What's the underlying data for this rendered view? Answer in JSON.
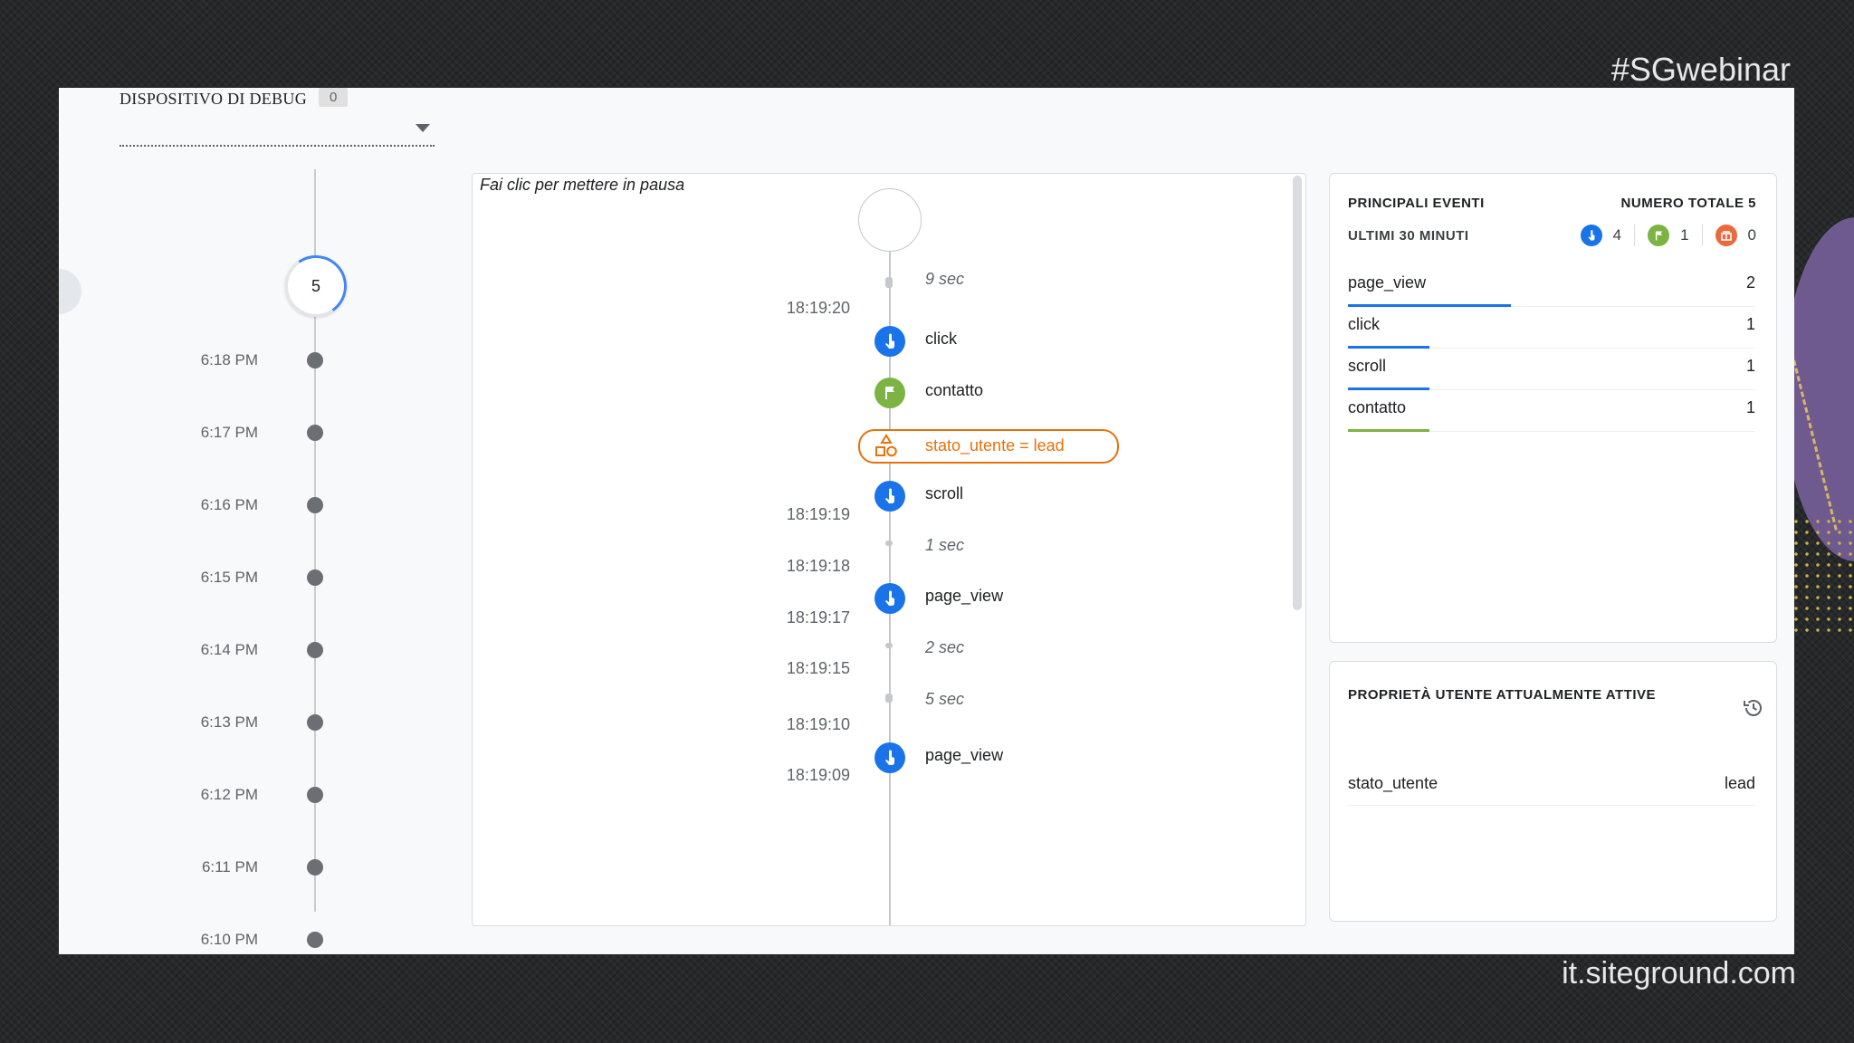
{
  "overlay": {
    "hashtag": "#SGwebinar",
    "site": "it.siteground.com"
  },
  "device": {
    "label": "DISPOSITIVO DI DEBUG",
    "count": "0"
  },
  "minutes": {
    "current_count": "5",
    "items": [
      "6:18 PM",
      "6:17 PM",
      "6:16 PM",
      "6:15 PM",
      "6:14 PM",
      "6:13 PM",
      "6:12 PM",
      "6:11 PM",
      "6:10 PM"
    ]
  },
  "seconds": {
    "pause_hint": "Fai clic per mettere in pausa",
    "gaps": [
      "9 sec",
      "1 sec",
      "2 sec",
      "5 sec"
    ],
    "timestamps": [
      "18:19:20",
      "18:19:19",
      "18:19:18",
      "18:19:17",
      "18:19:15",
      "18:19:10",
      "18:19:09"
    ],
    "events": [
      "click",
      "contatto",
      "scroll",
      "page_view",
      "page_view"
    ],
    "user_property": "stato_utente = lead"
  },
  "top_events": {
    "title": "PRINCIPALI EVENTI",
    "total": "NUMERO TOTALE 5",
    "period": "ULTIMI 30 MINUTI",
    "counts": {
      "standard": "4",
      "conversions": "1",
      "errors": "0"
    },
    "rows": [
      {
        "name": "page_view",
        "value": "2"
      },
      {
        "name": "click",
        "value": "1"
      },
      {
        "name": "scroll",
        "value": "1"
      },
      {
        "name": "contatto",
        "value": "1"
      }
    ]
  },
  "user_props": {
    "title": "PROPRIETÀ UTENTE ATTUALMENTE ATTIVE",
    "rows": [
      {
        "key": "stato_utente",
        "value": "lead"
      }
    ]
  },
  "colors": {
    "blue": "#1a73e8",
    "green": "#7cb342",
    "orange": "#e8710a"
  }
}
